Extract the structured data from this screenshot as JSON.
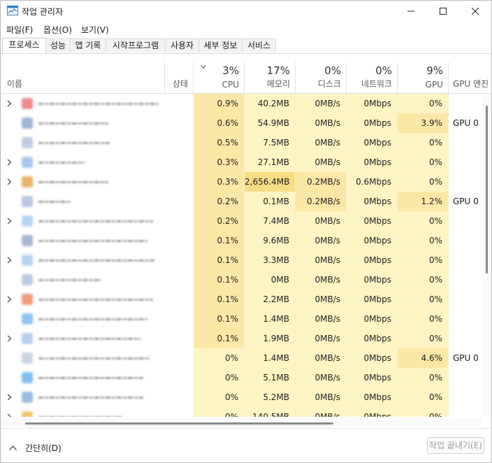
{
  "window": {
    "title": "작업 관리자"
  },
  "menu": [
    "파일(F)",
    "옵션(O)",
    "보기(V)"
  ],
  "tabs": [
    "프로세스",
    "성능",
    "앱 기록",
    "시작프로그램",
    "사용자",
    "세부 정보",
    "서비스"
  ],
  "header": {
    "name": "이름",
    "status": "상태",
    "cpu_pct": "3%",
    "cpu": "CPU",
    "mem_pct": "17%",
    "mem": "메모리",
    "disk_pct": "0%",
    "disk": "디스크",
    "net_pct": "0%",
    "net": "네트워크",
    "gpu_pct": "9%",
    "gpu": "GPU",
    "gpu_engine": "GPU 엔진"
  },
  "rows": [
    {
      "cpu": "0.9%",
      "mem": "40.2MB",
      "disk": "0MB/s",
      "net": "0Mbps",
      "gpu": "0%",
      "eng": ""
    },
    {
      "cpu": "0.6%",
      "mem": "54.9MB",
      "disk": "0MB/s",
      "net": "0Mbps",
      "gpu": "3.9%",
      "eng": "GPU 0"
    },
    {
      "cpu": "0.5%",
      "mem": "7.5MB",
      "disk": "0MB/s",
      "net": "0Mbps",
      "gpu": "0%",
      "eng": ""
    },
    {
      "cpu": "0.3%",
      "mem": "27.1MB",
      "disk": "0MB/s",
      "net": "0Mbps",
      "gpu": "0%",
      "eng": ""
    },
    {
      "cpu": "0.3%",
      "mem": "2,656.4MB",
      "disk": "0.2MB/s",
      "net": "0.6Mbps",
      "gpu": "0%",
      "eng": ""
    },
    {
      "cpu": "0.2%",
      "mem": "0.1MB",
      "disk": "0.2MB/s",
      "net": "0Mbps",
      "gpu": "1.2%",
      "eng": "GPU 0"
    },
    {
      "cpu": "0.2%",
      "mem": "7.4MB",
      "disk": "0MB/s",
      "net": "0Mbps",
      "gpu": "0%",
      "eng": ""
    },
    {
      "cpu": "0.1%",
      "mem": "9.6MB",
      "disk": "0MB/s",
      "net": "0Mbps",
      "gpu": "0%",
      "eng": ""
    },
    {
      "cpu": "0.1%",
      "mem": "3.3MB",
      "disk": "0MB/s",
      "net": "0Mbps",
      "gpu": "0%",
      "eng": ""
    },
    {
      "cpu": "0.1%",
      "mem": "0MB",
      "disk": "0MB/s",
      "net": "0Mbps",
      "gpu": "0%",
      "eng": ""
    },
    {
      "cpu": "0.1%",
      "mem": "2.2MB",
      "disk": "0MB/s",
      "net": "0Mbps",
      "gpu": "0%",
      "eng": ""
    },
    {
      "cpu": "0.1%",
      "mem": "1.4MB",
      "disk": "0MB/s",
      "net": "0Mbps",
      "gpu": "0%",
      "eng": ""
    },
    {
      "cpu": "0.1%",
      "mem": "1.9MB",
      "disk": "0MB/s",
      "net": "0Mbps",
      "gpu": "0%",
      "eng": ""
    },
    {
      "cpu": "0%",
      "mem": "1.4MB",
      "disk": "0MB/s",
      "net": "0Mbps",
      "gpu": "4.6%",
      "eng": "GPU 0"
    },
    {
      "cpu": "0%",
      "mem": "5.1MB",
      "disk": "0MB/s",
      "net": "0Mbps",
      "gpu": "0%",
      "eng": ""
    },
    {
      "cpu": "0%",
      "mem": "5.2MB",
      "disk": "0MB/s",
      "net": "0Mbps",
      "gpu": "0%",
      "eng": ""
    },
    {
      "cpu": "0%",
      "mem": "140.5MB",
      "disk": "0MB/s",
      "net": "0Mbps",
      "gpu": "0%",
      "eng": ""
    }
  ],
  "footer": {
    "collapse": "간단히(D)",
    "end_task": "작업 끝내기(E)"
  },
  "colors": {
    "cell_light": "#fff4c4",
    "cell_medium": "#fce8a6",
    "cell_strong": "#f9dc86",
    "accent": "#0067c0"
  }
}
